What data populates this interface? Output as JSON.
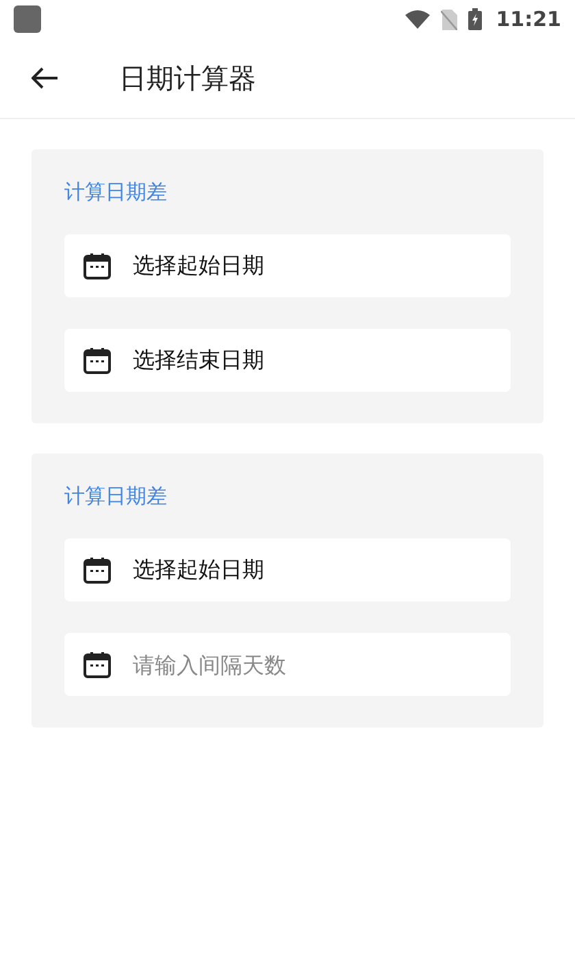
{
  "status_bar": {
    "time": "11:21"
  },
  "app_bar": {
    "title": "日期计算器"
  },
  "sections": [
    {
      "title": "计算日期差",
      "fields": [
        {
          "kind": "picker",
          "value": "选择起始日期"
        },
        {
          "kind": "picker",
          "value": "选择结束日期"
        }
      ]
    },
    {
      "title": "计算日期差",
      "fields": [
        {
          "kind": "picker",
          "value": "选择起始日期"
        },
        {
          "kind": "input",
          "placeholder": "请输入间隔天数"
        }
      ]
    }
  ]
}
